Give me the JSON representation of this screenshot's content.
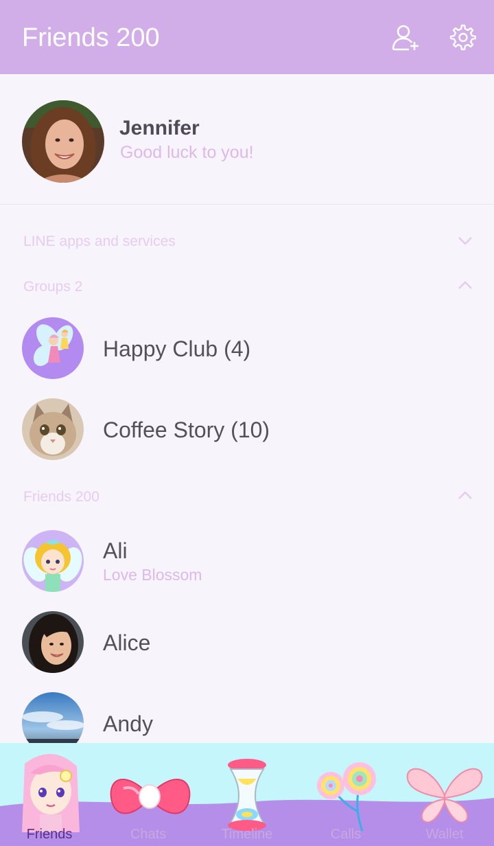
{
  "header": {
    "title": "Friends 200"
  },
  "profile": {
    "name": "Jennifer",
    "status": "Good luck to you!"
  },
  "sections": {
    "services": {
      "label": "LINE apps and services",
      "expanded": false
    },
    "groups": {
      "label": "Groups 2",
      "expanded": true
    },
    "friends": {
      "label": "Friends 200",
      "expanded": true
    }
  },
  "groups": [
    {
      "name": "Happy Club (4)"
    },
    {
      "name": "Coffee Story (10)"
    }
  ],
  "friends": [
    {
      "name": "Ali",
      "status": "Love Blossom"
    },
    {
      "name": "Alice",
      "status": ""
    },
    {
      "name": "Andy",
      "status": ""
    }
  ],
  "tabs": [
    {
      "label": "Friends",
      "icon": "fairy-girl-icon",
      "active": true
    },
    {
      "label": "Chats",
      "icon": "ribbon-bow-icon",
      "active": false
    },
    {
      "label": "Timeline",
      "icon": "hourglass-icon",
      "active": false
    },
    {
      "label": "Calls",
      "icon": "swirl-flowers-icon",
      "active": false
    },
    {
      "label": "Wallet",
      "icon": "butterfly-wings-icon",
      "active": false
    }
  ],
  "colors": {
    "header_bg": "#d2aee8",
    "page_bg": "#f8f4fc",
    "accent_text": "#dcb9ea",
    "tabbar_sky": "#c4f6fb",
    "tabbar_hill": "#b48ee8"
  }
}
